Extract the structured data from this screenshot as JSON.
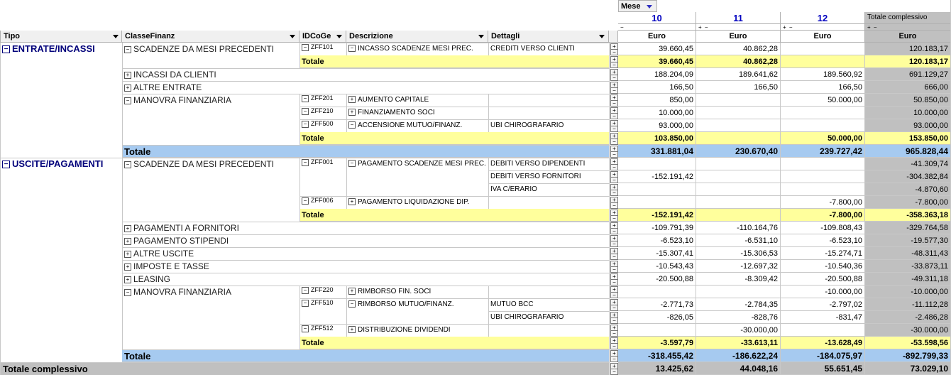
{
  "pivot": {
    "filter_field": "Mese",
    "row_fields": [
      "Tipo",
      "ClasseFinanz",
      "IDCoGe",
      "Descrizione",
      "Dettagli"
    ],
    "columns": [
      "10",
      "11",
      "12"
    ],
    "grand_total_column": "Totale complessivo",
    "measure": "Euro",
    "total_label": "Totale",
    "grand_total_label": "Totale complessivo",
    "col_toggle_symbols": [
      "−",
      "+ −",
      "+ −",
      "+ −"
    ]
  },
  "rows": [
    {
      "tipo": "ENTRATE/INCASSI",
      "tipo_toggle": "−",
      "classe": "SCADENZE DA MESI PRECEDENTI",
      "classe_toggle": "−",
      "idcoge": "ZFF101",
      "id_toggle": "−",
      "descr": "INCASSO SCADENZE MESI PREC.",
      "descr_toggle": "−",
      "dett": "CREDITI VERSO CLIENTI",
      "v10": "39.660,45",
      "v11": "40.862,28",
      "v12": "",
      "tot": "120.183,17",
      "type": "data"
    },
    {
      "total": "Totale",
      "v10": "39.660,45",
      "v11": "40.862,28",
      "v12": "",
      "tot": "120.183,17",
      "type": "subtotal"
    },
    {
      "classe": "INCASSI DA CLIENTI",
      "classe_toggle": "+",
      "v10": "188.204,09",
      "v11": "189.641,62",
      "v12": "189.560,92",
      "tot": "691.129,27",
      "type": "data"
    },
    {
      "classe": "ALTRE ENTRATE",
      "classe_toggle": "+",
      "v10": "166,50",
      "v11": "166,50",
      "v12": "166,50",
      "tot": "666,00",
      "type": "data"
    },
    {
      "classe": "MANOVRA FINANZIARIA",
      "classe_toggle": "−",
      "idcoge": "ZFF201",
      "id_toggle": "−",
      "descr": "AUMENTO CAPITALE",
      "descr_toggle": "+",
      "v10": "850,00",
      "v11": "",
      "v12": "50.000,00",
      "tot": "50.850,00",
      "type": "data"
    },
    {
      "idcoge": "ZFF210",
      "id_toggle": "−",
      "descr": "FINANZIAMENTO SOCI",
      "descr_toggle": "+",
      "v10": "10.000,00",
      "v11": "",
      "v12": "",
      "tot": "10.000,00",
      "type": "data"
    },
    {
      "idcoge": "ZFF500",
      "id_toggle": "−",
      "descr": "ACCENSIONE MUTUO/FINANZ.",
      "descr_toggle": "−",
      "dett": "UBI CHIROGRAFARIO",
      "v10": "93.000,00",
      "v11": "",
      "v12": "",
      "tot": "93.000,00",
      "type": "data"
    },
    {
      "total": "Totale",
      "v10": "103.850,00",
      "v11": "",
      "v12": "50.000,00",
      "tot": "153.850,00",
      "type": "subtotal"
    },
    {
      "total": "Totale",
      "v10": "331.881,04",
      "v11": "230.670,40",
      "v12": "239.727,42",
      "tot": "965.828,44",
      "type": "tipototal"
    },
    {
      "tipo": "USCITE/PAGAMENTI",
      "tipo_toggle": "−",
      "classe": "SCADENZE DA MESI PRECEDENTI",
      "classe_toggle": "−",
      "idcoge": "ZFF001",
      "id_toggle": "−",
      "descr": "PAGAMENTO SCADENZE MESI PREC.",
      "descr_toggle": "−",
      "dett": "DEBITI VERSO DIPENDENTI",
      "v10": "",
      "v11": "",
      "v12": "",
      "tot": "-41.309,74",
      "type": "data"
    },
    {
      "dett": "DEBITI VERSO FORNITORI",
      "v10": "-152.191,42",
      "v11": "",
      "v12": "",
      "tot": "-304.382,84",
      "type": "data"
    },
    {
      "dett": "IVA C/ERARIO",
      "v10": "",
      "v11": "",
      "v12": "",
      "tot": "-4.870,60",
      "type": "data"
    },
    {
      "idcoge": "ZFF006",
      "id_toggle": "−",
      "descr": "PAGAMENTO LIQUIDAZIONE DIP.",
      "descr_toggle": "+",
      "v10": "",
      "v11": "",
      "v12": "-7.800,00",
      "tot": "-7.800,00",
      "type": "data"
    },
    {
      "total": "Totale",
      "v10": "-152.191,42",
      "v11": "",
      "v12": "-7.800,00",
      "tot": "-358.363,18",
      "type": "subtotal"
    },
    {
      "classe": "PAGAMENTI A FORNITORI",
      "classe_toggle": "+",
      "v10": "-109.791,39",
      "v11": "-110.164,76",
      "v12": "-109.808,43",
      "tot": "-329.764,58",
      "type": "data"
    },
    {
      "classe": "PAGAMENTO STIPENDI",
      "classe_toggle": "+",
      "v10": "-6.523,10",
      "v11": "-6.531,10",
      "v12": "-6.523,10",
      "tot": "-19.577,30",
      "type": "data"
    },
    {
      "classe": "ALTRE USCITE",
      "classe_toggle": "+",
      "v10": "-15.307,41",
      "v11": "-15.306,53",
      "v12": "-15.274,71",
      "tot": "-48.311,43",
      "type": "data"
    },
    {
      "classe": "IMPOSTE E TASSE",
      "classe_toggle": "+",
      "v10": "-10.543,43",
      "v11": "-12.697,32",
      "v12": "-10.540,36",
      "tot": "-33.873,11",
      "type": "data"
    },
    {
      "classe": "LEASING",
      "classe_toggle": "+",
      "v10": "-20.500,88",
      "v11": "-8.309,42",
      "v12": "-20.500,88",
      "tot": "-49.311,18",
      "type": "data"
    },
    {
      "classe": "MANOVRA FINANZIARIA",
      "classe_toggle": "−",
      "idcoge": "ZFF220",
      "id_toggle": "−",
      "descr": "RIMBORSO FIN. SOCI",
      "descr_toggle": "+",
      "v10": "",
      "v11": "",
      "v12": "-10.000,00",
      "tot": "-10.000,00",
      "type": "data"
    },
    {
      "idcoge": "ZFF510",
      "id_toggle": "−",
      "descr": "RIMBORSO MUTUO/FINANZ.",
      "descr_toggle": "−",
      "dett": "MUTUO BCC",
      "v10": "-2.771,73",
      "v11": "-2.784,35",
      "v12": "-2.797,02",
      "tot": "-11.112,28",
      "type": "data"
    },
    {
      "dett": "UBI CHIROGRAFARIO",
      "v10": "-826,05",
      "v11": "-828,76",
      "v12": "-831,47",
      "tot": "-2.486,28",
      "type": "data"
    },
    {
      "idcoge": "ZFF512",
      "id_toggle": "−",
      "descr": "DISTRIBUZIONE DIVIDENDI",
      "descr_toggle": "+",
      "v10": "",
      "v11": "-30.000,00",
      "v12": "",
      "tot": "-30.000,00",
      "type": "data"
    },
    {
      "total": "Totale",
      "v10": "-3.597,79",
      "v11": "-33.613,11",
      "v12": "-13.628,49",
      "tot": "-53.598,56",
      "type": "subtotal"
    },
    {
      "total": "Totale",
      "v10": "-318.455,42",
      "v11": "-186.622,24",
      "v12": "-184.075,97",
      "tot": "-892.799,33",
      "type": "tipototal"
    },
    {
      "total": "Totale complessivo",
      "v10": "13.425,62",
      "v11": "44.048,16",
      "v12": "55.651,45",
      "tot": "73.029,10",
      "type": "grandtotal"
    }
  ],
  "colors": {
    "subtotal_bg": "#ffff9c",
    "tipototal_bg": "#a6caf0",
    "grandtotal_bg": "#c0c0c0",
    "total_col_bg": "#c0c0c0",
    "tipo_text": "#00007a",
    "month_text": "#0000c0"
  }
}
